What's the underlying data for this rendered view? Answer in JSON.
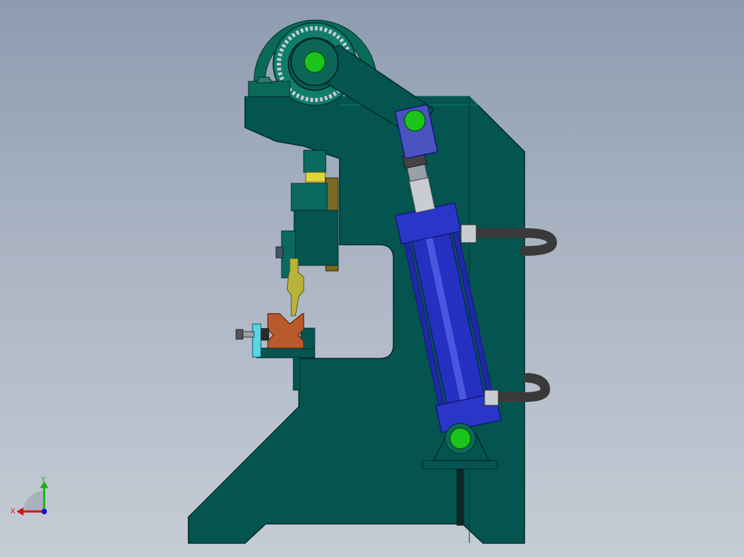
{
  "viewport": {
    "background_top": "#8e9cb0",
    "background_bottom": "#c6ccd5"
  },
  "colors": {
    "frame": "#04544f",
    "frame_edge": "#012a27",
    "bearing": "#0a6a58",
    "pin": "#1bc41b",
    "cylinder": "#2430c0",
    "cylinder_dark": "#141a7a",
    "clevis": "#4a52c0",
    "rod": "#c9cdd2",
    "hose": "#3a3a3a",
    "die": "#b85a2c",
    "punch": "#b8b43a",
    "clamp_plate": "#57d6e6",
    "axis_x": "#d21414",
    "axis_y": "#14b414",
    "axis_z": "#1414d2"
  },
  "triad": {
    "x_label": "X",
    "y_label": "Y"
  }
}
